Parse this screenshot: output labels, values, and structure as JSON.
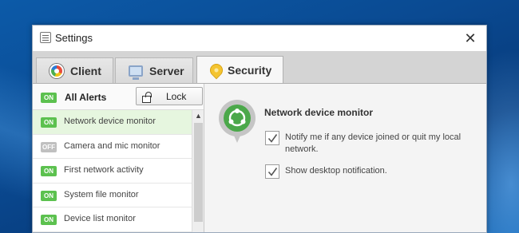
{
  "window": {
    "title": "Settings",
    "close_glyph": "✕"
  },
  "tabs": [
    {
      "label": "Client",
      "icon": "client-icon",
      "active": false
    },
    {
      "label": "Server",
      "icon": "server-icon",
      "active": false
    },
    {
      "label": "Security",
      "icon": "security-icon",
      "active": true
    }
  ],
  "alerts": {
    "header": {
      "status": "ON",
      "title": "All Alerts",
      "lock_label": "Lock"
    },
    "items": [
      {
        "status": "ON",
        "label": "Network device monitor",
        "selected": true
      },
      {
        "status": "OFF",
        "label": "Camera and mic monitor",
        "selected": false
      },
      {
        "status": "ON",
        "label": "First network activity",
        "selected": false
      },
      {
        "status": "ON",
        "label": "System file monitor",
        "selected": false
      },
      {
        "status": "ON",
        "label": "Device list monitor",
        "selected": false
      }
    ]
  },
  "detail": {
    "title": "Network device monitor",
    "icon": "network-device-icon",
    "options": [
      {
        "label": "Notify me if any device joined or quit my local network.",
        "checked": true
      },
      {
        "label": "Show desktop notification.",
        "checked": true
      }
    ]
  },
  "colors": {
    "on_badge": "#5cc14f",
    "off_badge": "#c0c0c0",
    "selected_row": "#e6f6df",
    "monitor_green": "#4ba84a"
  }
}
